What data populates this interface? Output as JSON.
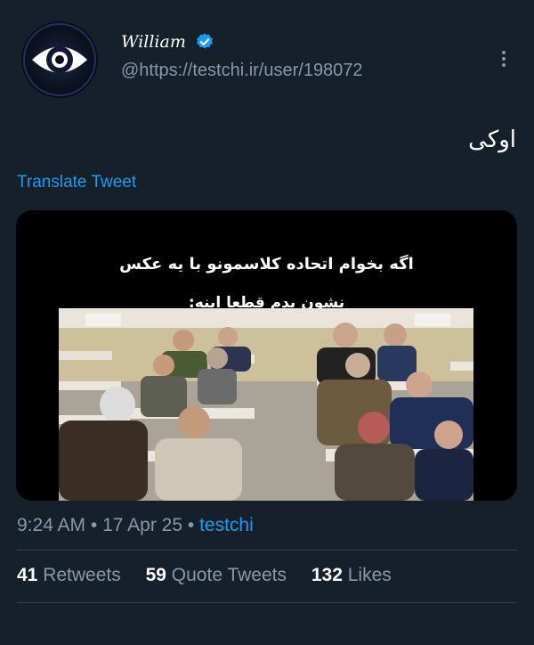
{
  "user": {
    "display_name": "William",
    "handle": "@https://testchi.ir/user/198072",
    "verified": true
  },
  "tweet": {
    "text": "اوکی",
    "translate_label": "Translate Tweet",
    "media": {
      "caption_line1": "اگه بخوام اتحاده کلاسمونو با یه عکس",
      "caption_line2": "نشون بدم قطعا اینه:"
    },
    "time": "9:24 AM",
    "date": "17 Apr 25",
    "source": "testchi",
    "separator": "•"
  },
  "stats": {
    "retweets_count": "41",
    "retweets_label": "Retweets",
    "quotes_count": "59",
    "quotes_label": "Quote Tweets",
    "likes_count": "132",
    "likes_label": "Likes"
  },
  "colors": {
    "background": "#15202b",
    "link": "#1d9bf0",
    "secondary_text": "#8899a6",
    "verified_badge": "#1d9bf0"
  }
}
